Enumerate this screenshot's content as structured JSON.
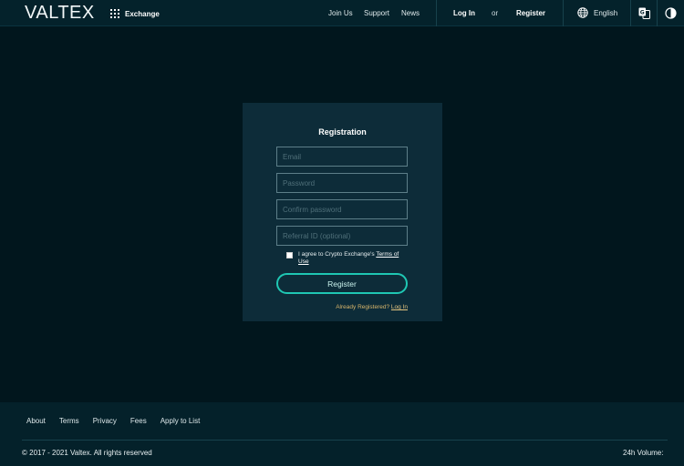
{
  "header": {
    "logo": "VALTEX",
    "exchange_label": "Exchange",
    "nav": {
      "join_us": "Join Us",
      "support": "Support",
      "news": "News"
    },
    "login": "Log In",
    "or": "or",
    "register": "Register",
    "language": "English"
  },
  "registration": {
    "title": "Registration",
    "email_placeholder": "Email",
    "password_placeholder": "Password",
    "confirm_password_placeholder": "Confirm password",
    "referral_placeholder": "Referral ID (optional)",
    "agree_text": "I agree to Crypto Exchange's ",
    "terms_link": "Terms of Use",
    "register_button": "Register",
    "already_text": "Already Registered? ",
    "login_link": "Log In"
  },
  "footer": {
    "links": [
      "About",
      "Terms",
      "Privacy",
      "Fees",
      "Apply to List"
    ],
    "copyright": "© 2017 - 2021 Valtex. All rights reserved",
    "volume_label": "24h Volume:"
  },
  "colors": {
    "background": "#01161d",
    "card": "#0d2c39",
    "accent": "#1fc7b3",
    "link_gold": "#d7b46a"
  }
}
